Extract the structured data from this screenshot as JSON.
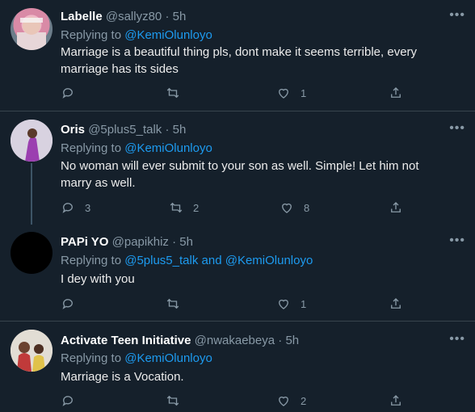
{
  "tweets": [
    {
      "name": "Labelle",
      "handle": "@sallyz80",
      "sep": "·",
      "time": "5h",
      "replying_prefix": "Replying to",
      "replying_to": "@KemiOlunloyo",
      "replying_join": "",
      "replying_to_2": "",
      "text": "Marriage is a beautiful thing pls, dont make it seems terrible,  every marriage has its sides",
      "replies": "",
      "retweets": "",
      "likes": "1"
    },
    {
      "name": "Oris",
      "handle": "@5plus5_talk",
      "sep": "·",
      "time": "5h",
      "replying_prefix": "Replying to",
      "replying_to": "@KemiOlunloyo",
      "replying_join": "",
      "replying_to_2": "",
      "text": "No woman will ever submit to your son as well. Simple! Let him not marry as well.",
      "replies": "3",
      "retweets": "2",
      "likes": "8"
    },
    {
      "name": "PAPi YO",
      "handle": "@papikhiz",
      "sep": "·",
      "time": "5h",
      "replying_prefix": "Replying to",
      "replying_to": "@5plus5_talk",
      "replying_join": "and",
      "replying_to_2": "@KemiOlunloyo",
      "text": "I dey with you",
      "replies": "",
      "retweets": "",
      "likes": "1"
    },
    {
      "name": "Activate Teen Initiative",
      "handle": "@nwakaebeya",
      "sep": "·",
      "time": "5h",
      "replying_prefix": "Replying to",
      "replying_to": "@KemiOlunloyo",
      "replying_join": "",
      "replying_to_2": "",
      "text": "Marriage is a Vocation.",
      "replies": "",
      "retweets": "",
      "likes": "2"
    }
  ],
  "colors": {
    "background": "#15202b",
    "divider": "#38444d",
    "mention": "#1d9bf0",
    "muted": "#8899a6"
  },
  "icons": [
    "reply-icon",
    "retweet-icon",
    "like-icon",
    "share-icon",
    "more-icon"
  ]
}
